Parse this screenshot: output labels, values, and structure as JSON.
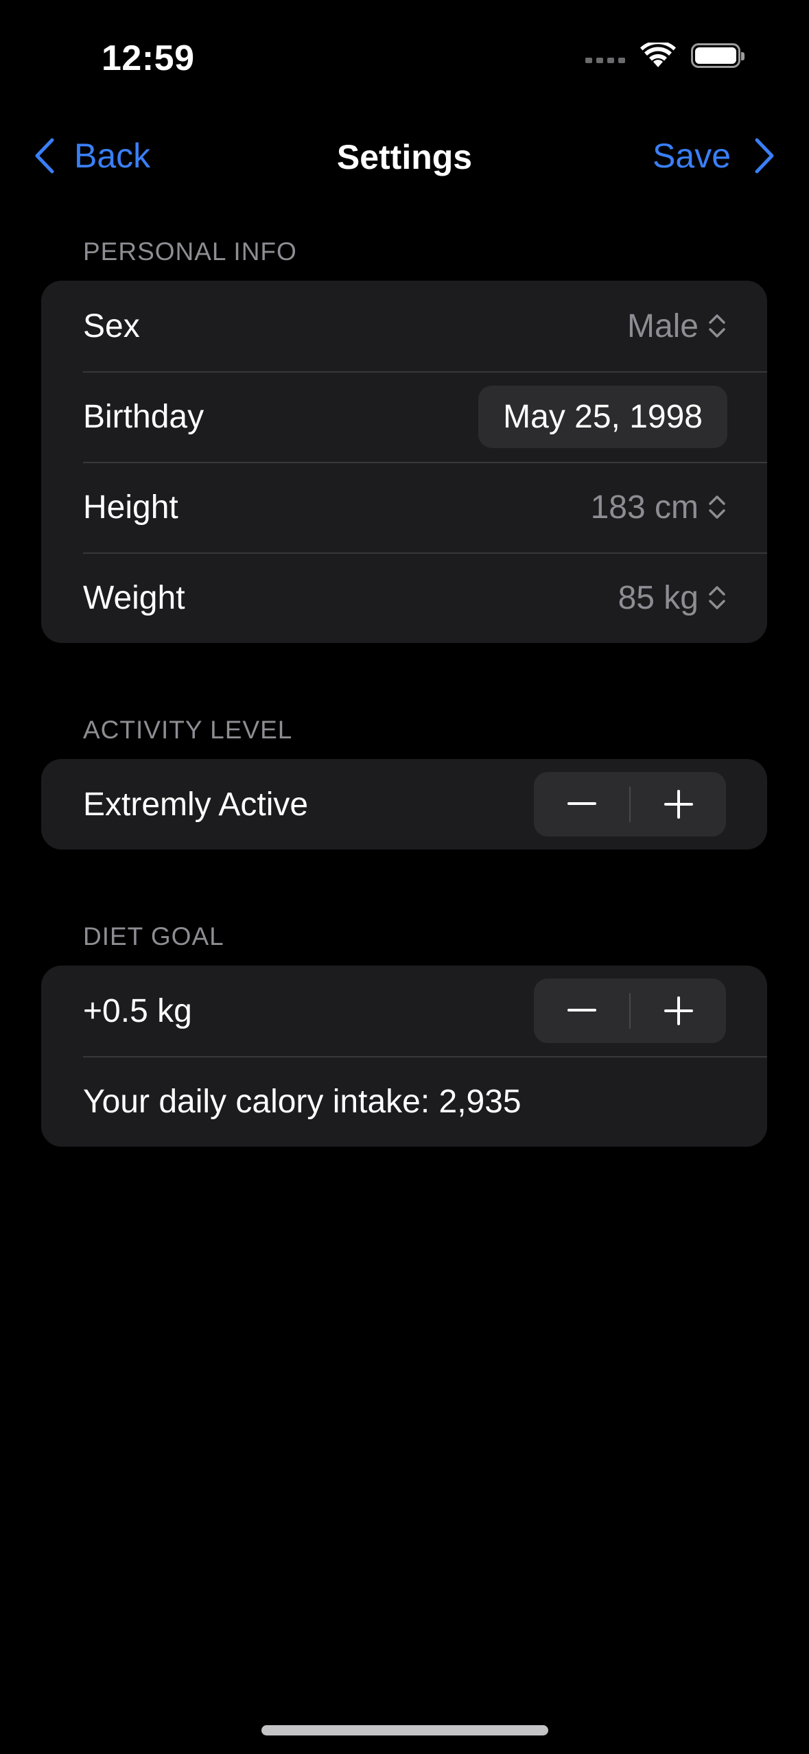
{
  "status_bar": {
    "time": "12:59",
    "icons": [
      "cellular-signal-icon",
      "wifi-icon",
      "battery-icon"
    ]
  },
  "nav": {
    "back_label": "Back",
    "title": "Settings",
    "save_label": "Save"
  },
  "personal_info": {
    "header": "PERSONAL INFO",
    "sex": {
      "label": "Sex",
      "value": "Male"
    },
    "birthday": {
      "label": "Birthday",
      "value": "May 25, 1998"
    },
    "height": {
      "label": "Height",
      "value": "183 cm"
    },
    "weight": {
      "label": "Weight",
      "value": "85 kg"
    }
  },
  "activity": {
    "header": "ACTIVITY LEVEL",
    "value": "Extremly Active"
  },
  "diet_goal": {
    "header": "DIET GOAL",
    "value": "+0.5 kg",
    "calorie_text": "Your daily calory intake: 2,935"
  },
  "colors": {
    "accent": "#3a7ff6",
    "background": "#000000",
    "group_background": "#1c1c1e",
    "secondary_text": "#8d8d93"
  }
}
